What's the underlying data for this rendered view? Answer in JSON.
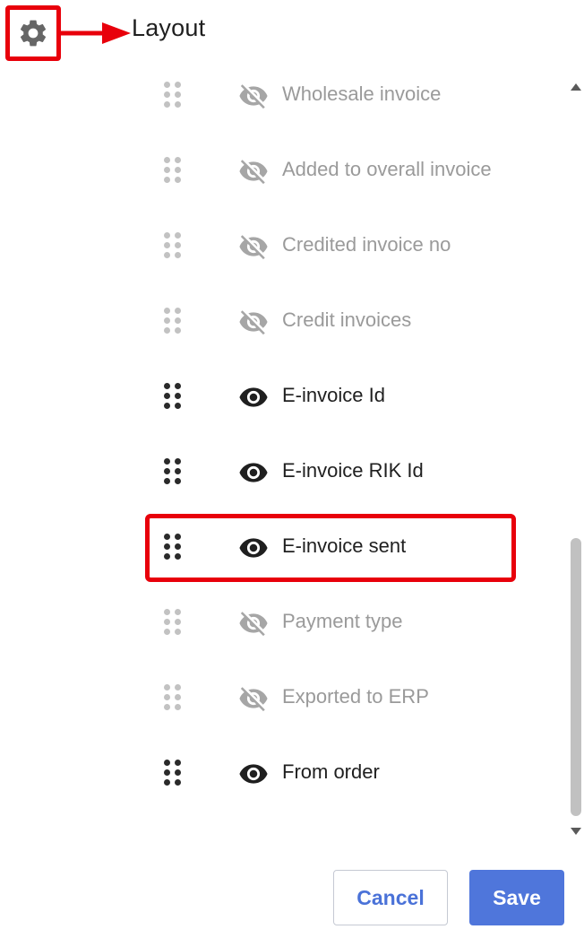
{
  "header": {
    "title": "Layout",
    "settings_icon": "gear-icon"
  },
  "colors": {
    "annotation": "#e8000b",
    "primary": "#4f76db",
    "muted": "#9a9a9a",
    "active": "#1f1f1f"
  },
  "columns": [
    {
      "label": "Wholesale invoice",
      "visible": false
    },
    {
      "label": "Added to overall invoice",
      "visible": false
    },
    {
      "label": "Credited invoice no",
      "visible": false
    },
    {
      "label": "Credit invoices",
      "visible": false
    },
    {
      "label": "E-invoice Id",
      "visible": true
    },
    {
      "label": "E-invoice RIK Id",
      "visible": true
    },
    {
      "label": "E-invoice sent",
      "visible": true,
      "highlighted": true
    },
    {
      "label": "Payment type",
      "visible": false
    },
    {
      "label": "Exported to ERP",
      "visible": false
    },
    {
      "label": "From order",
      "visible": true
    }
  ],
  "footer": {
    "cancel_label": "Cancel",
    "save_label": "Save"
  }
}
